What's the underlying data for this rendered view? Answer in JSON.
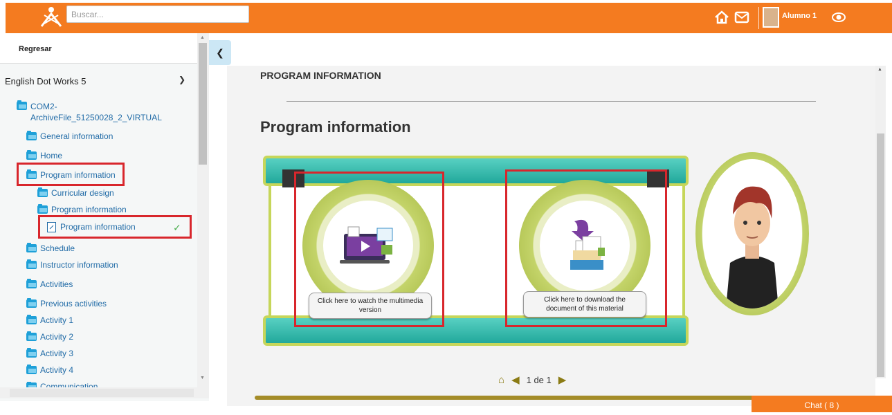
{
  "topbar": {
    "search_placeholder": "Buscar...",
    "user_name": "Alumno 1",
    "icons": [
      "home-icon",
      "mail-icon",
      "user-avatar",
      "eye-icon"
    ],
    "accent_color": "#f47b20"
  },
  "sidebar": {
    "back_label": "Regresar",
    "course_title": "English Dot Works 5",
    "items": [
      {
        "label": "COM2-",
        "label2": "ArchiveFile_51250028_2_VIRTUAL",
        "icon": "folder-icon"
      },
      {
        "label": "General information",
        "icon": "folder-icon"
      },
      {
        "label": "Home",
        "icon": "folder-icon"
      },
      {
        "label": "Program information",
        "icon": "folder-icon"
      },
      {
        "label": "Curricular design",
        "icon": "folder-icon"
      },
      {
        "label": "Program information",
        "icon": "folder-icon"
      },
      {
        "label": "Program information",
        "icon": "document-icon",
        "completed": true
      },
      {
        "label": "Schedule",
        "icon": "folder-icon"
      },
      {
        "label": "Instructor information",
        "icon": "folder-icon"
      },
      {
        "label": "Activities",
        "icon": "folder-icon"
      },
      {
        "label": "Previous activities",
        "icon": "folder-icon"
      },
      {
        "label": "Activity 1",
        "icon": "folder-icon"
      },
      {
        "label": "Activity 2",
        "icon": "folder-icon"
      },
      {
        "label": "Activity 3",
        "icon": "folder-icon"
      },
      {
        "label": "Activity 4",
        "icon": "folder-icon"
      },
      {
        "label": "Communication",
        "icon": "folder-icon"
      }
    ]
  },
  "content": {
    "section_title": "PROGRAM INFORMATION",
    "page_title": "Program information",
    "card_multimedia": "Click here to watch the multimedia version",
    "card_download": "Click here to download the document of this material",
    "pager_text": "1 de 1"
  },
  "chat_label": "Chat ( 8 )"
}
